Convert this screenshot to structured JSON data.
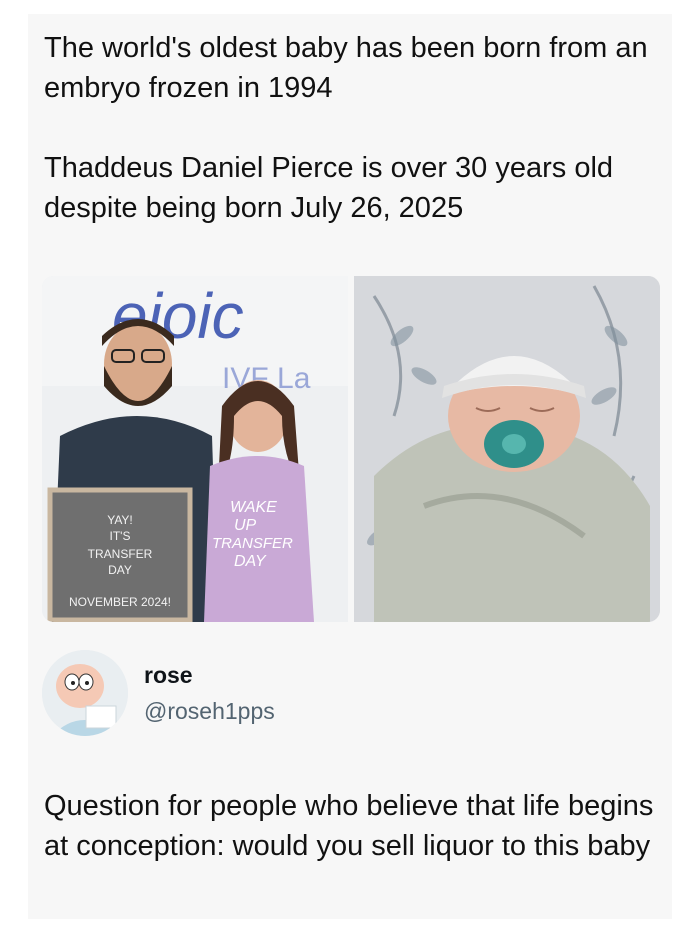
{
  "quoted_post": {
    "line1": "The world's oldest baby has been born from an embryo frozen in 1994",
    "line2": "Thaddeus Daniel Pierce is over 30 years old despite being born July 26, 2025"
  },
  "photo_left": {
    "clinic_sign_top": "ejoic",
    "clinic_sign_bottom": "IVF La",
    "letterboard": [
      "YAY!",
      "IT'S",
      "TRANSFER",
      "DAY"
    ],
    "letterboard_date": "NOVEMBER 2024!",
    "shirt_text": [
      "WAKE",
      "UP",
      "TRANSFER",
      "DAY"
    ]
  },
  "author": {
    "display_name": "rose",
    "handle": "@roseh1pps"
  },
  "tweet": {
    "text": "Question for people who believe that life begins at conception: would you sell liquor to this baby"
  }
}
